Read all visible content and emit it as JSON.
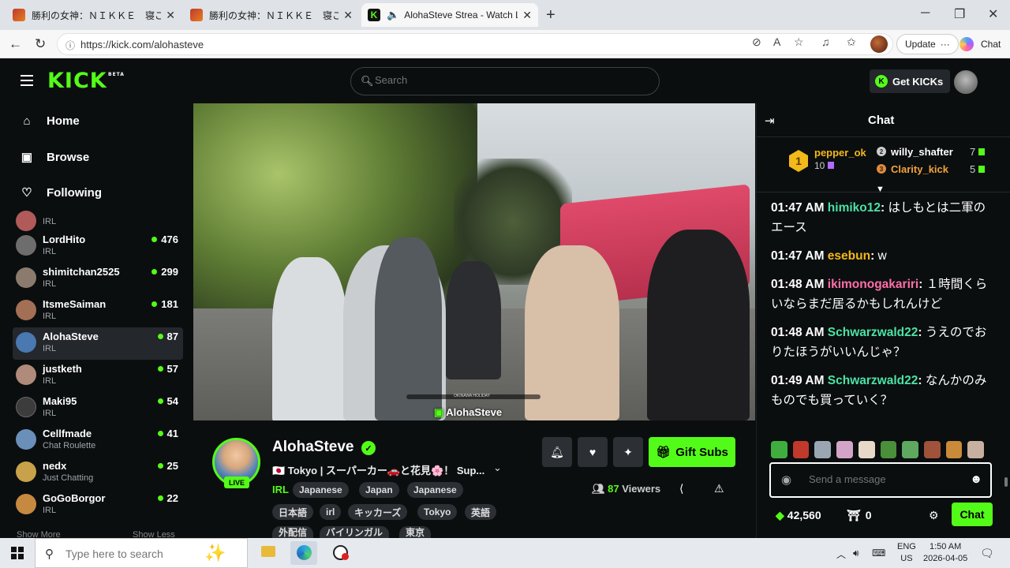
{
  "browser": {
    "tabs": [
      {
        "title": "勝利の女神：ＮＩＫＫＥ　寝ころび",
        "active": false
      },
      {
        "title": "勝利の女神：ＮＩＫＫＥ　寝ころび",
        "active": false
      },
      {
        "title": "AlohaSteve Strea - Watch Li",
        "active": true
      }
    ],
    "url": "https://kick.com/alohasteve",
    "update_label": "Update",
    "chat_label": "Chat"
  },
  "kick": {
    "logo": "KICK",
    "logo_badge": "BETA",
    "search_placeholder": "Search",
    "get_kicks": "Get KICKs",
    "nav": [
      {
        "label": "Home",
        "icon": "home-icon"
      },
      {
        "label": "Browse",
        "icon": "browse-icon"
      },
      {
        "label": "Following",
        "icon": "heart-icon"
      }
    ],
    "partial_channel_category": "IRL",
    "channels": [
      {
        "name": "LordHito",
        "category": "IRL",
        "viewers": "476",
        "color": "#6d6d6d"
      },
      {
        "name": "shimitchan2525",
        "category": "IRL",
        "viewers": "299",
        "color": "#8b7a6e"
      },
      {
        "name": "ItsmeSaiman",
        "category": "IRL",
        "viewers": "181",
        "color": "#a36f55"
      },
      {
        "name": "AlohaSteve",
        "category": "IRL",
        "viewers": "87",
        "color": "#4a78b0",
        "selected": true
      },
      {
        "name": "justketh",
        "category": "IRL",
        "viewers": "57",
        "color": "#b08a7a"
      },
      {
        "name": "Maki95",
        "category": "IRL",
        "viewers": "54",
        "color": "#3c3c3c"
      },
      {
        "name": "Cellfmade",
        "category": "Chat Roulette",
        "viewers": "41",
        "color": "#6a8fb8"
      },
      {
        "name": "nedx",
        "category": "Just Chatting",
        "viewers": "25",
        "color": "#c7a24a"
      },
      {
        "name": "GoGoBorgor",
        "category": "IRL",
        "viewers": "22",
        "color": "#c58a40"
      }
    ],
    "show_more": "Show More",
    "show_less": "Show Less",
    "stream": {
      "streamer": "AlohaSteve",
      "live_badge": "LIVE",
      "title": "🇯🇵 Tokyo | スーパーカー🚗と花見🌸！ Sup...",
      "category": "IRL",
      "tags_row1": [
        "Japanese",
        "Japan",
        "Japanese"
      ],
      "tags_row2": [
        "日本語",
        "irl",
        "キッカーズ",
        "Tokyo",
        "英語"
      ],
      "tags_row3": [
        "外配信",
        "バイリンガル",
        "東京"
      ],
      "gift_subs": "Gift Subs",
      "viewer_count": "87",
      "viewers_label": "Viewers",
      "watermark": "AlohaSteve",
      "overlay_text": "OKINAWA HOLIDAY"
    },
    "chat": {
      "header": "Chat",
      "leaderboard": {
        "first": {
          "name": "pepper_ok",
          "count": "10",
          "rank": "1"
        },
        "second": {
          "name": "willy_shafter",
          "count": "7"
        },
        "third": {
          "name": "Clarity_kick",
          "count": "5"
        }
      },
      "messages": [
        {
          "time": "01:47 AM",
          "user": "himiko12",
          "color": "#4be3a6",
          "text": "はしもとは二軍のエース"
        },
        {
          "time": "01:47 AM",
          "user": "esebun",
          "color": "#f3b81a",
          "text": "w"
        },
        {
          "time": "01:48 AM",
          "user": "ikimonogakariri",
          "color": "#ff6fa8",
          "text": "１時間くらいならまだ居るかもしれんけど"
        },
        {
          "time": "01:48 AM",
          "user": "Schwarzwald22",
          "color": "#4be3a6",
          "text": "うえのでおりたほうがいいんじゃ？"
        },
        {
          "time": "01:49 AM",
          "user": "Schwarzwald22",
          "color": "#4be3a6",
          "text": "なんかのみものでも買っていく？"
        }
      ],
      "send_placeholder": "Send a message",
      "kicks_balance": "42,560",
      "subs_balance": "0",
      "chat_button": "Chat"
    }
  },
  "taskbar": {
    "search_placeholder": "Type here to search",
    "lang_top": "ENG",
    "lang_bottom": "US",
    "time": "1:50 AM",
    "date": "2026-04-05"
  },
  "colors": {
    "kick_green": "#53fc18",
    "bg": "#0b0e0f",
    "panel": "#24272c"
  }
}
